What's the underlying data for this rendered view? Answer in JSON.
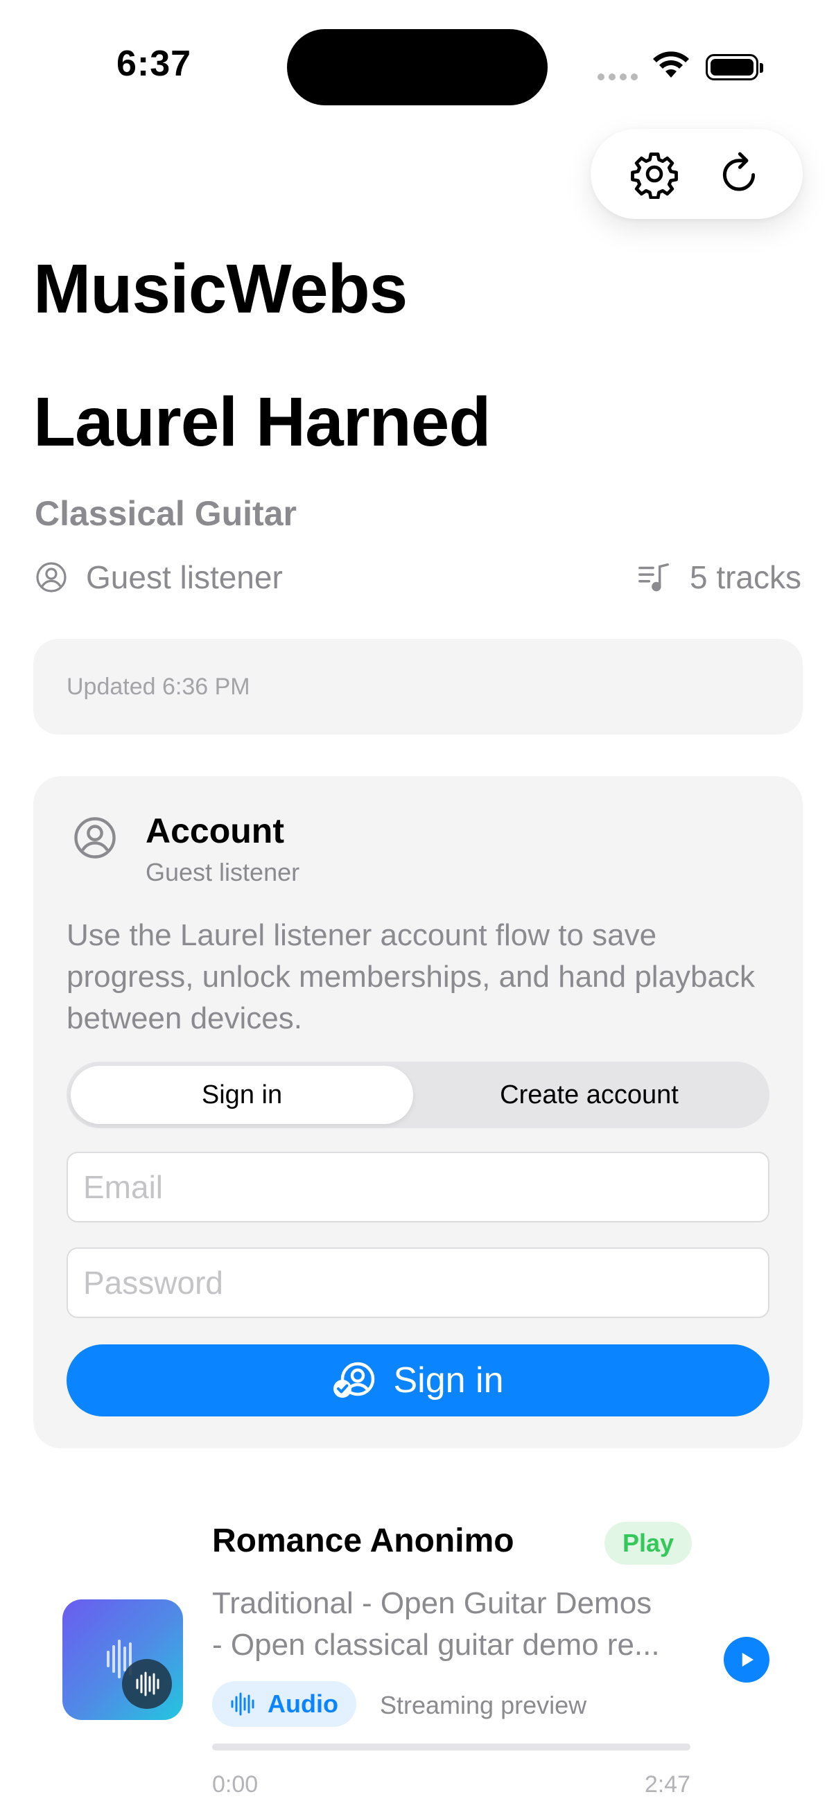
{
  "status_bar": {
    "time": "6:37"
  },
  "toolbar": {
    "settings_icon": "gear-icon",
    "refresh_icon": "refresh-icon"
  },
  "app": {
    "title": "MusicWebs"
  },
  "artist": {
    "name": "Laurel Harned",
    "genre": "Classical Guitar",
    "listener_status": "Guest listener",
    "track_count": "5 tracks"
  },
  "updated": {
    "text": "Updated 6:36 PM"
  },
  "account": {
    "title": "Account",
    "subtitle": "Guest listener",
    "description": "Use the Laurel listener account flow to save progress, unlock memberships, and hand playback between devices.",
    "tabs": [
      {
        "label": "Sign in",
        "active": true
      },
      {
        "label": "Create account",
        "active": false
      }
    ],
    "email_placeholder": "Email",
    "password_placeholder": "Password",
    "submit_label": "Sign in"
  },
  "track": {
    "title": "Romance Anonimo",
    "badge": "Play",
    "description_line1": "Traditional - Open Guitar Demos",
    "description_line2": "- Open classical guitar demo re...",
    "media_type": "Audio",
    "stream_label": "Streaming preview",
    "progress": 0,
    "time_elapsed": "0:00",
    "time_total": "2:47"
  },
  "colors": {
    "accent": "#0a84ff",
    "play_green": "#34c759",
    "secondary_text": "#8a8a8f"
  }
}
